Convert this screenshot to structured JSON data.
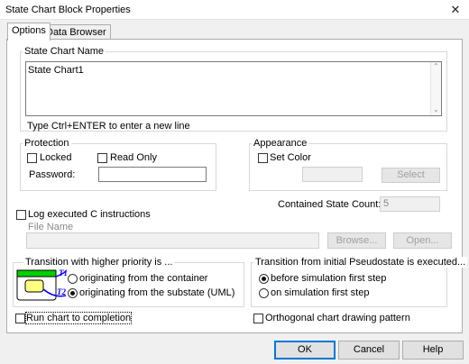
{
  "window": {
    "title": "State Chart Block Properties",
    "close_glyph": "✕"
  },
  "tabs": [
    {
      "label": "Options"
    },
    {
      "label": "Data Browser"
    }
  ],
  "name_group": {
    "label": "State Chart Name",
    "value": "State Chart1",
    "hint": "Type Ctrl+ENTER to enter a new line"
  },
  "protection": {
    "label": "Protection",
    "locked_label": "Locked",
    "locked_checked": false,
    "readonly_label": "Read Only",
    "readonly_checked": false,
    "password_label": "Password:",
    "password_value": ""
  },
  "appearance": {
    "label": "Appearance",
    "set_color_label": "Set Color",
    "set_color_checked": false,
    "select_label": "Select"
  },
  "contained": {
    "label": "Contained State Count:",
    "value": "5"
  },
  "log": {
    "label": "Log executed C instructions",
    "checked": false,
    "file_name_label": "File Name",
    "file_name_value": "",
    "browse_label": "Browse...",
    "open_label": "Open..."
  },
  "priority": {
    "label": "Transition with higher priority is ...",
    "option1": "originating from the container",
    "option2": "originating from the substate (UML)",
    "selected": "option2",
    "diagram_label_top": "T1",
    "diagram_label_bottom": "T2",
    "colors": {
      "outer_fill": "#00d000",
      "inner_fill": "#ffff80",
      "arrow": "#0000ff"
    }
  },
  "initial": {
    "label": "Transition from initial Pseudostate is executed...",
    "option1": "before simulation first step",
    "option2": "on simulation first step",
    "selected": "option1"
  },
  "run_to_completion": {
    "label": "Run chart to completion",
    "checked": false
  },
  "orthogonal": {
    "label": "Orthogonal chart drawing pattern",
    "checked": false
  },
  "footer": {
    "ok": "OK",
    "cancel": "Cancel",
    "help": "Help"
  }
}
